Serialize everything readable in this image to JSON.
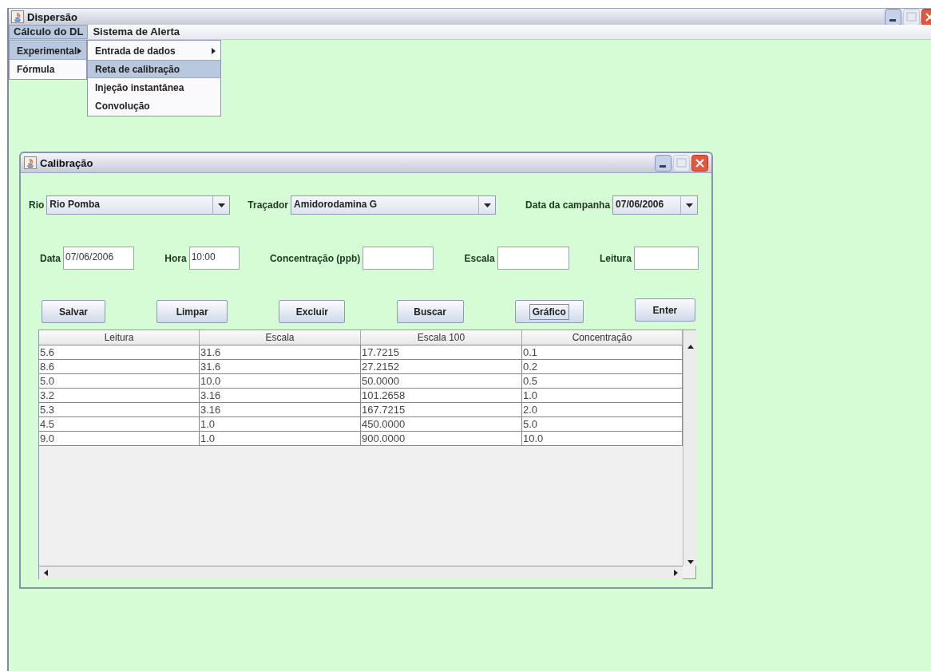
{
  "window": {
    "title": "Dispersão"
  },
  "menubar": [
    {
      "label": "Cálculo do DL",
      "selected": true
    },
    {
      "label": "Sistema de Alerta",
      "selected": false
    }
  ],
  "menu": [
    {
      "label": "Experimental",
      "selected": true,
      "submenu": true
    },
    {
      "label": "Fórmula",
      "selected": false,
      "submenu": false
    }
  ],
  "submenu": [
    {
      "label": "Entrada de dados",
      "selected": false,
      "submenu": true
    },
    {
      "label": "Reta de calibração",
      "selected": true,
      "submenu": false
    },
    {
      "label": "Injeção instantânea",
      "selected": false,
      "submenu": false
    },
    {
      "label": "Convolução",
      "selected": false,
      "submenu": false
    }
  ],
  "frame": {
    "title": "Calibração",
    "row_1": [
      {
        "label": "Rio",
        "kind": "combo",
        "value": "Rio Pomba"
      },
      {
        "label": "Traçador",
        "kind": "combo",
        "value": "Amidorodamina G"
      },
      {
        "label": "Data da campanha",
        "kind": "combo",
        "value": "07/06/2006"
      }
    ],
    "row_2": [
      {
        "label": "Data",
        "kind": "text",
        "value": "07/06/2006"
      },
      {
        "label": "Hora",
        "kind": "text",
        "value": "10:00"
      },
      {
        "label": "Concentração (ppb)",
        "kind": "text"
      },
      {
        "label": "Escala",
        "kind": "text"
      },
      {
        "label": "Leitura",
        "kind": "text"
      }
    ],
    "buttons": [
      {
        "label": "Salvar",
        "focused": false
      },
      {
        "label": "Limpar",
        "focused": false
      },
      {
        "label": "Excluir",
        "focused": false
      },
      {
        "label": "Buscar",
        "focused": false
      },
      {
        "label": "Gráfico",
        "focused": true
      },
      {
        "label": "Enter",
        "focused": false
      }
    ],
    "table": {
      "columns": [
        "Leitura",
        "Escala",
        "Escala 100",
        "Concentração"
      ],
      "rows": [
        [
          "5.6",
          "31.6",
          "17.7215",
          "0.1"
        ],
        [
          "8.6",
          "31.6",
          "27.2152",
          "0.2"
        ],
        [
          "5.0",
          "10.0",
          "50.0000",
          "0.5"
        ],
        [
          "3.2",
          "3.16",
          "101.2658",
          "1.0"
        ],
        [
          "5.3",
          "3.16",
          "167.7215",
          "2.0"
        ],
        [
          "4.5",
          "1.0",
          "450.0000",
          "5.0"
        ],
        [
          "9.0",
          "1.0",
          "900.0000",
          "10.0"
        ]
      ]
    }
  }
}
